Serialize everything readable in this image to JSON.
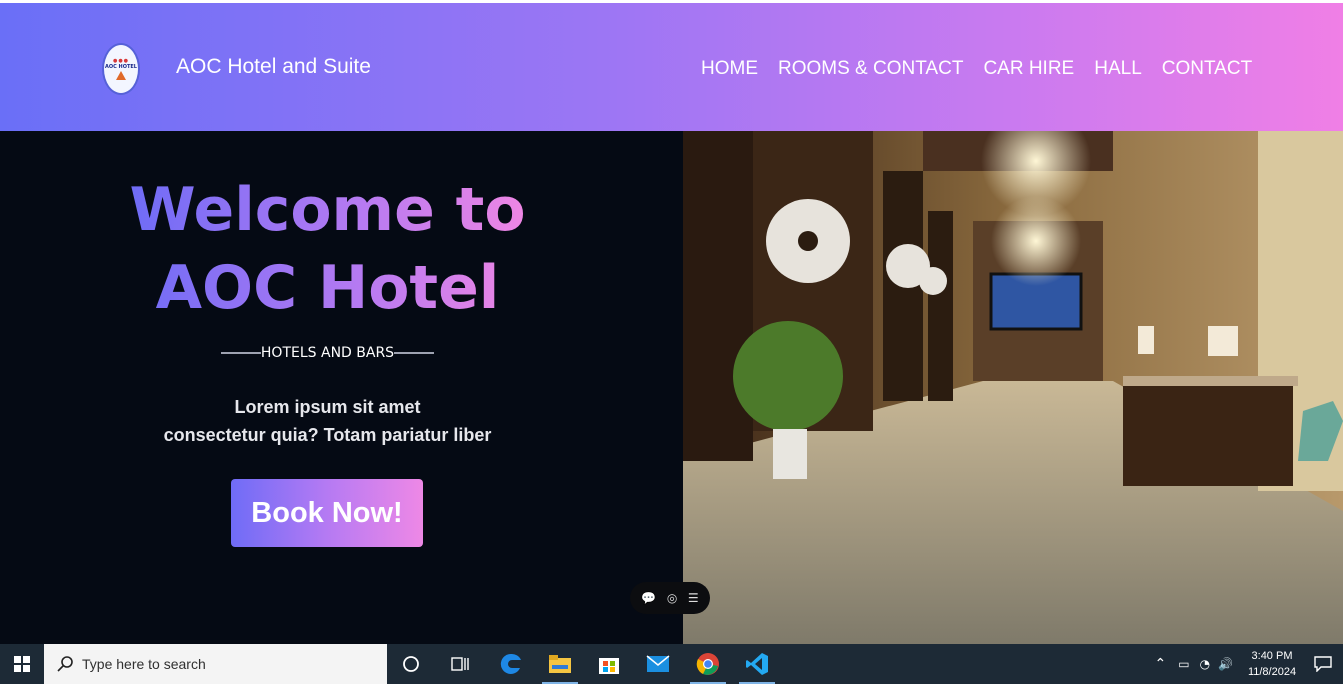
{
  "header": {
    "brand": "AOC Hotel and Suite",
    "logo_text": "AOC HOTEL",
    "nav": [
      "HOME",
      "ROOMS & CONTACT",
      "CAR HIRE",
      "HALL",
      "CONTACT"
    ]
  },
  "hero": {
    "title_line1": "Welcome to",
    "title_line2": "AOC Hotel",
    "subtitle": "HOTELS AND BARS",
    "desc_line1": "Lorem ipsum sit amet",
    "desc_line2": "consectetur quia? Totam pariatur liber",
    "cta": "Book Now!"
  },
  "taskbar": {
    "search_placeholder": "Type here to search",
    "time": "3:40 PM",
    "date": "11/8/2024",
    "pinned_icons": [
      "task-view-icon",
      "timeline-icon",
      "edge-icon",
      "file-explorer-icon",
      "store-icon",
      "mail-icon",
      "chrome-icon",
      "vscode-icon"
    ]
  },
  "colors": {
    "header_start": "#6a6ff7",
    "header_end": "#f07fe6",
    "hero_bg": "#050a14",
    "taskbar_bg": "#1d2a36"
  }
}
